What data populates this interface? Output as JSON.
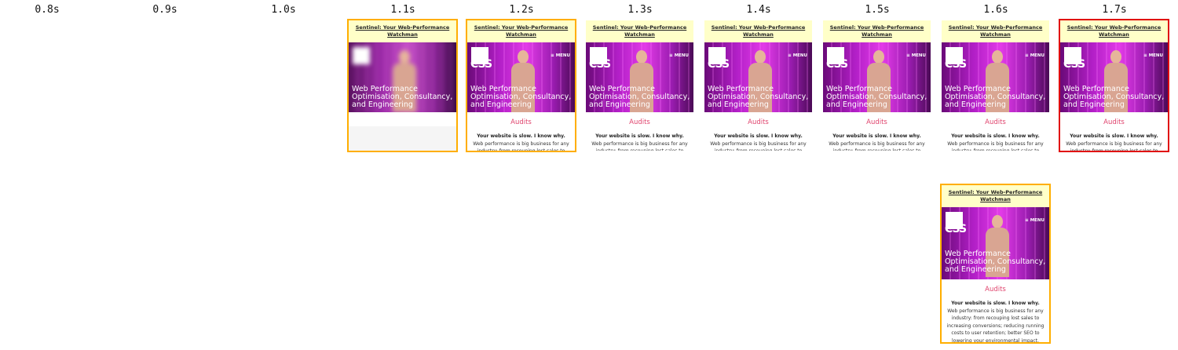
{
  "filmstrip": {
    "timestamps": [
      "0.8s",
      "0.9s",
      "1.0s",
      "1.1s",
      "1.2s",
      "1.3s",
      "1.4s",
      "1.5s",
      "1.6s",
      "1.7s"
    ]
  },
  "page": {
    "banner": "Sentinel: Your Web-Performance Watchman",
    "logo": "CSS",
    "menu": "≡ MENU",
    "tagline": "Web Performance Optimisation, Consultancy, and Engineering",
    "audits": "Audits",
    "lead": "Your website is slow. I know why.",
    "body": "Web performance is big business for any industry: from recouping lost sales to increasing conversions; reducing running costs to user retention; better SEO to lowering your environmental impact."
  },
  "colors": {
    "highlight_changed": "#ffae00",
    "highlight_final": "#e10a0a",
    "banner_bg": "#ffffc8",
    "audits_pink": "#e0456e"
  }
}
